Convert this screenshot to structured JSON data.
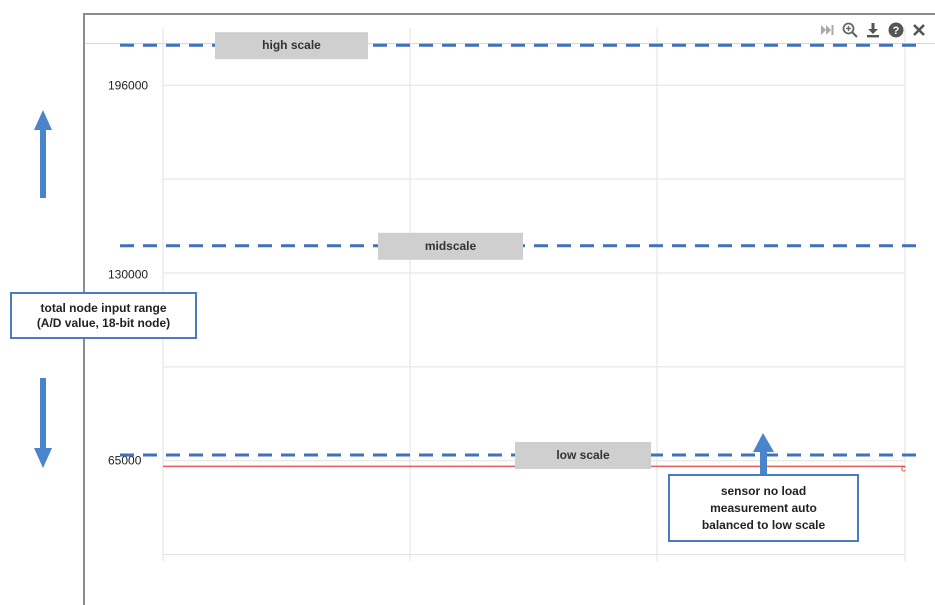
{
  "toolbar": {
    "icons": [
      "skip-to-end-icon",
      "zoom-in-icon",
      "download-icon",
      "help-icon",
      "close-icon"
    ]
  },
  "chart_data": {
    "type": "line",
    "title": "",
    "xlabel": "",
    "ylabel": "",
    "ylim": [
      30000,
      216000
    ],
    "y_ticks": [
      65000,
      130000,
      196000
    ],
    "y_tick_labels": [
      "65000",
      "130000",
      "196000"
    ],
    "grid": true,
    "series": [
      {
        "values": [
          63000,
          63000
        ],
        "color": "#e06060"
      }
    ],
    "series_end_marker": "c",
    "reference_lines": [
      {
        "label": "high scale",
        "y": 210000,
        "style": "dashed",
        "color": "#3f72b8"
      },
      {
        "label": "midscale",
        "y": 140000,
        "style": "dashed",
        "color": "#3f72b8"
      },
      {
        "label": "low scale",
        "y": 67000,
        "style": "dashed",
        "color": "#3f72b8"
      }
    ],
    "annotations": {
      "range_note": [
        "total node input range",
        "(A/D value, 18-bit node)"
      ],
      "sensor_note": [
        "sensor  no load",
        "measurement auto",
        "balanced to low scale"
      ]
    }
  }
}
